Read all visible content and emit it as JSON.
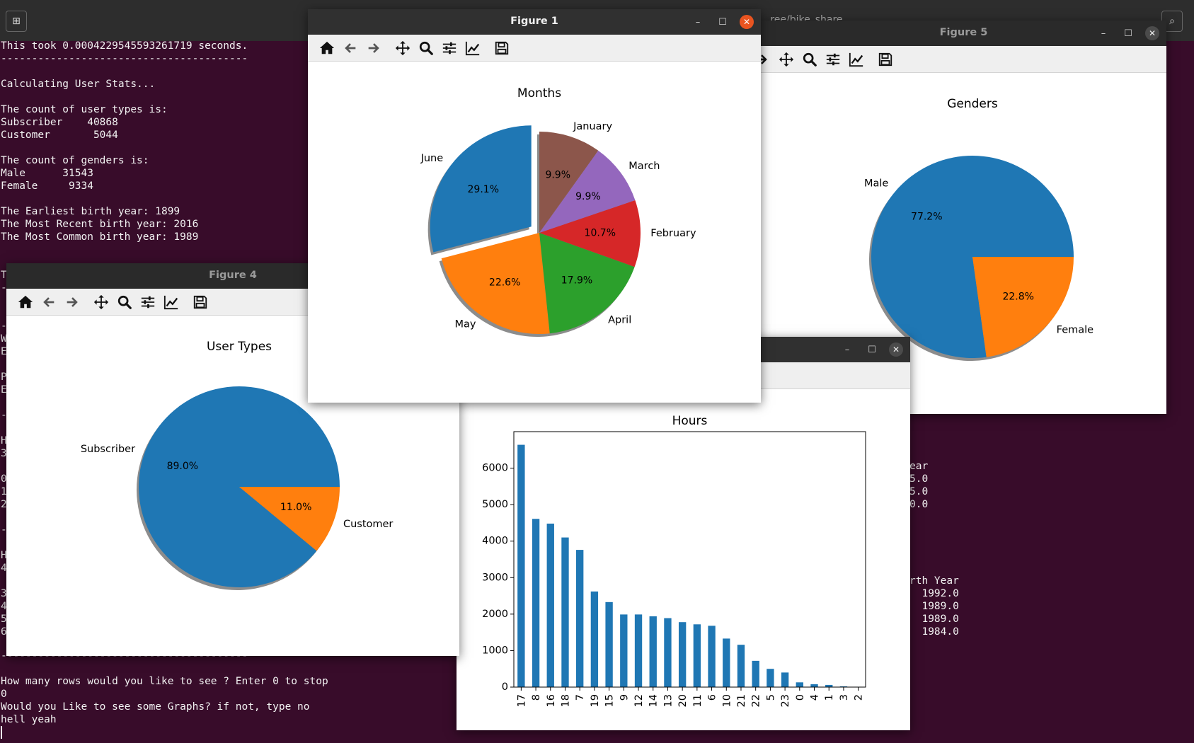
{
  "topbar": {
    "title_fragment": "...ree/bike_share"
  },
  "terminal": {
    "lines": [
      "This took 0.0004229545593261719 seconds.",
      "----------------------------------------",
      "",
      "Calculating User Stats...",
      "",
      "The count of user types is:",
      "Subscriber    40868",
      "Customer       5044",
      "",
      "The count of genders is:",
      "Male      31543",
      "Female     9334",
      "",
      "The Earliest birth year: 1899",
      "The Most Recent birth year: 2016",
      "The Most Common birth year: 1989"
    ],
    "left_fragments": [
      "T",
      "-",
      "",
      "",
      "-",
      "W",
      "E",
      "",
      "P",
      "E",
      "",
      "-",
      "",
      "H",
      "3",
      "",
      "0",
      "1",
      "2",
      "",
      "-",
      "",
      "H",
      "4",
      "",
      "3",
      "4",
      "5",
      "6"
    ],
    "right_fragments": [
      "ear",
      "5.0",
      "5.0",
      "0.0",
      "",
      "",
      "",
      "",
      "",
      "rth Year",
      "  1992.0",
      "  1989.0",
      "  1989.0",
      "  1984.0"
    ],
    "bottom_lines": [
      "----------------------------------------",
      "",
      "How many rows would you like to see ? Enter 0 to stop",
      "0",
      "Would you Like to see some Graphs? if not, type no",
      "hell yeah"
    ]
  },
  "windows": {
    "fig5": {
      "title": "Figure 5"
    },
    "fig4": {
      "title": "Figure 4"
    },
    "fig1": {
      "title": "Figure 1"
    },
    "fig_hours": {
      "title": ""
    }
  },
  "chart_data": [
    {
      "type": "pie",
      "title": "Months",
      "labels": [
        "June",
        "May",
        "April",
        "February",
        "March",
        "January"
      ],
      "values": [
        29.1,
        22.6,
        17.9,
        10.7,
        9.9,
        9.9
      ],
      "autopct": [
        "29.1%",
        "22.6%",
        "17.9%",
        "10.7%",
        "9.9%",
        "9.9%"
      ],
      "colors": [
        "#1f77b4",
        "#ff7f0e",
        "#2ca02c",
        "#d62728",
        "#9467bd",
        "#8c564b"
      ],
      "explode": [
        0.1,
        0,
        0,
        0,
        0,
        0
      ],
      "start_angle": 90,
      "shadow": true
    },
    {
      "type": "pie",
      "title": "Genders",
      "labels": [
        "Male",
        "Female"
      ],
      "values": [
        77.2,
        22.8
      ],
      "autopct": [
        "77.2%",
        "22.8%"
      ],
      "colors": [
        "#1f77b4",
        "#ff7f0e"
      ],
      "start_angle": 0,
      "shadow": true
    },
    {
      "type": "pie",
      "title": "User Types",
      "labels": [
        "Subscriber",
        "Customer"
      ],
      "values": [
        89.0,
        11.0
      ],
      "autopct": [
        "89.0%",
        "11.0%"
      ],
      "colors": [
        "#1f77b4",
        "#ff7f0e"
      ],
      "start_angle": 0,
      "shadow": true
    },
    {
      "type": "bar",
      "title": "Hours",
      "categories": [
        "17",
        "8",
        "16",
        "18",
        "7",
        "19",
        "15",
        "9",
        "12",
        "14",
        "13",
        "20",
        "11",
        "6",
        "10",
        "21",
        "22",
        "5",
        "23",
        "0",
        "4",
        "1",
        "3",
        "2"
      ],
      "values": [
        6640,
        4610,
        4480,
        4100,
        3760,
        2620,
        2330,
        1990,
        1990,
        1940,
        1890,
        1780,
        1720,
        1680,
        1330,
        1160,
        720,
        500,
        400,
        130,
        80,
        60,
        20,
        10
      ],
      "yticks": [
        0,
        1000,
        2000,
        3000,
        4000,
        5000,
        6000
      ],
      "ylim": [
        0,
        7000
      ],
      "color": "#1f77b4",
      "xlabel": "",
      "ylabel": ""
    }
  ]
}
